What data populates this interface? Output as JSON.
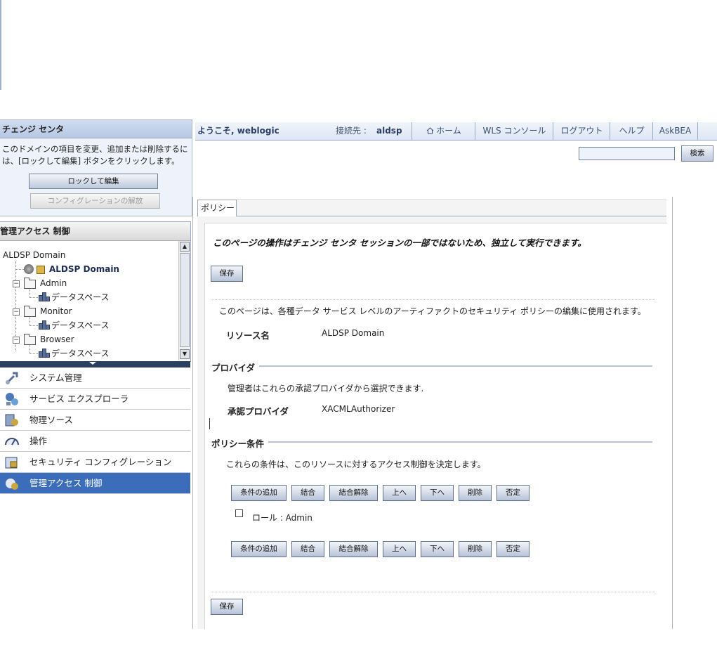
{
  "change_center": {
    "title": "チェンジ センタ",
    "description": "このドメインの項目を変更、追加または削除するには、[ロックして編集] ボタンをクリックします。",
    "lock_edit_label": "ロックして編集",
    "release_label": "コンフィグレーションの解放"
  },
  "admin_access": {
    "title": "管理アクセス 制御",
    "tree": {
      "root": "ALDSP Domain",
      "domain_node": "ALDSP Domain",
      "groups": [
        {
          "label": "Admin",
          "child": "データスペース"
        },
        {
          "label": "Monitor",
          "child": "データスペース"
        },
        {
          "label": "Browser",
          "child": "データスペース"
        }
      ]
    }
  },
  "nav": {
    "items": [
      {
        "label": "システム管理",
        "icon": "wrench-icon"
      },
      {
        "label": "サービス エクスプローラ",
        "icon": "service-explorer-icon"
      },
      {
        "label": "物理ソース",
        "icon": "physical-source-icon"
      },
      {
        "label": "操作",
        "icon": "operations-gauge-icon"
      },
      {
        "label": "セキュリティ コンフィグレーション",
        "icon": "security-config-icon"
      },
      {
        "label": "管理アクセス 制御",
        "icon": "admin-access-icon",
        "active": true
      }
    ]
  },
  "topbar": {
    "welcome": "ようこそ, weblogic",
    "connected_label": "接続先 :",
    "connected_value": "aldsp",
    "links": {
      "home": "ホーム",
      "wls_console": "WLS コンソール",
      "logout": "ログアウト",
      "help": "ヘルプ",
      "askbea": "AskBEA"
    },
    "search_button": "検索",
    "search_value": ""
  },
  "content": {
    "tab": "ポリシー",
    "notice": "このページの操作はチェンジ センタ セッションの一部ではないため、独立して実行できます。",
    "save_label": "保存",
    "description": "このページは、各種データ サービス レベルのアーティファクトのセキュリティ ポリシーの編集に使用されます。",
    "resource_label": "リソース名",
    "resource_value": "ALDSP Domain",
    "provider_section": "プロバイダ",
    "provider_desc": "管理者はこれらの承認プロバイダから選択できます.",
    "provider_label": "承認プロバイダ",
    "provider_value": "XACMLAuthorizer",
    "policy_section": "ポリシー条件",
    "policy_desc": "これらの条件は、このリソースに対するアクセス制御を決定します。",
    "condition_buttons": {
      "add": "条件の追加",
      "combine": "結合",
      "uncombine": "結合解除",
      "up": "上へ",
      "down": "下へ",
      "delete": "削除",
      "negate": "否定"
    },
    "role_condition": "ロール : Admin",
    "role_checked": false
  }
}
